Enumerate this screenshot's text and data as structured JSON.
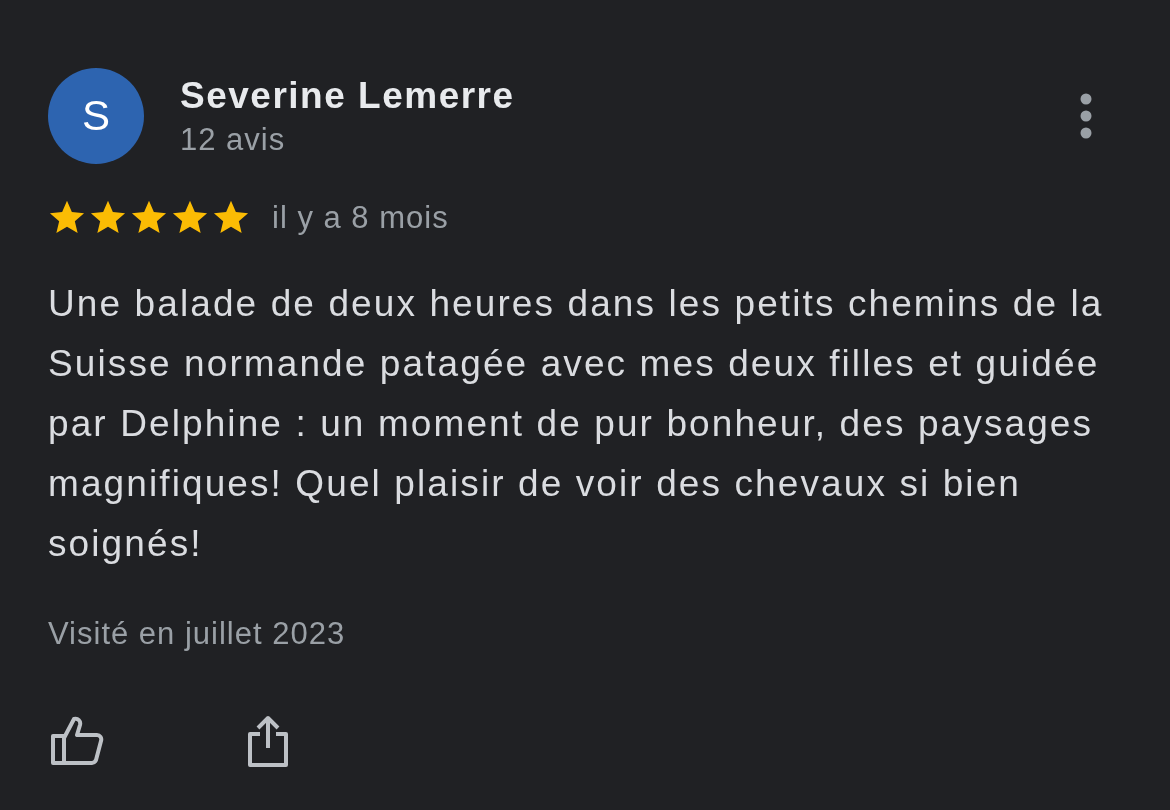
{
  "review": {
    "avatar_letter": "S",
    "author": "Severine Lemerre",
    "review_count": "12 avis",
    "stars": 5,
    "time": "il y a 8 mois",
    "text": "Une balade de deux heures dans les petits chemins de la Suisse normande patagée avec mes deux filles et guidée par Delphine : un moment de pur bonheur, des paysages magnifiques! Quel plaisir de voir des chevaux si bien soignés!",
    "visit": "Visité en juillet 2023"
  }
}
